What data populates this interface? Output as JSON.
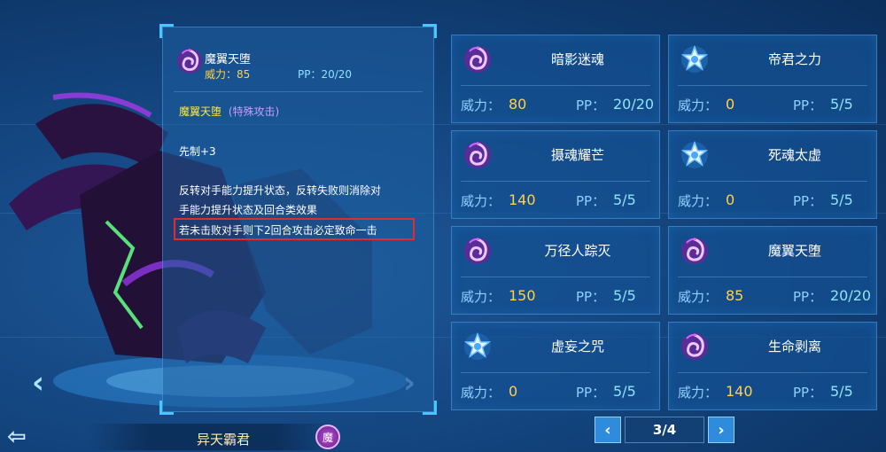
{
  "detail": {
    "name": "魔翼天堕",
    "power_label": "威力：85",
    "pp_label": "PP：20/20",
    "skill_name": "魔翼天堕",
    "skill_category": "(特殊攻击)",
    "priority": "先制+3",
    "effect_line1": "反转对手能力提升状态，反转失败则消除对",
    "effect_line2": "手能力提升状态及回合类效果",
    "effect_line3": "若未击败对手则下2回合攻击必定致命一击"
  },
  "pet": {
    "name": "异天霸君",
    "attribute_badge": "魔"
  },
  "skills": [
    {
      "name": "暗影迷魂",
      "power_label": "威力：",
      "power": "80",
      "pp_label": "PP：",
      "pp": "20/20",
      "icon": "shadow-swirl-icon"
    },
    {
      "name": "帝君之力",
      "power_label": "威力：",
      "power": "0",
      "pp_label": "PP：",
      "pp": "5/5",
      "icon": "star-icon"
    },
    {
      "name": "摄魂耀芒",
      "power_label": "威力：",
      "power": "140",
      "pp_label": "PP：",
      "pp": "5/5",
      "icon": "shadow-swirl-icon"
    },
    {
      "name": "死魂太虚",
      "power_label": "威力：",
      "power": "0",
      "pp_label": "PP：",
      "pp": "5/5",
      "icon": "star-icon"
    },
    {
      "name": "万径人踪灭",
      "power_label": "威力：",
      "power": "150",
      "pp_label": "PP：",
      "pp": "5/5",
      "icon": "shadow-swirl-icon"
    },
    {
      "name": "魔翼天堕",
      "power_label": "威力：",
      "power": "85",
      "pp_label": "PP：",
      "pp": "20/20",
      "icon": "shadow-swirl-icon"
    },
    {
      "name": "虚妄之咒",
      "power_label": "威力：",
      "power": "0",
      "pp_label": "PP：",
      "pp": "5/5",
      "icon": "star-icon"
    },
    {
      "name": "生命剥离",
      "power_label": "威力：",
      "power": "140",
      "pp_label": "PP：",
      "pp": "5/5",
      "icon": "shadow-swirl-icon"
    }
  ],
  "pager": {
    "prev": "‹",
    "page": "3/4",
    "next": "›"
  },
  "colors": {
    "power_value": "#ffd24a",
    "pp_value": "#8fe3ff",
    "highlight": "#e22c2c",
    "accent": "#43c8ff"
  }
}
